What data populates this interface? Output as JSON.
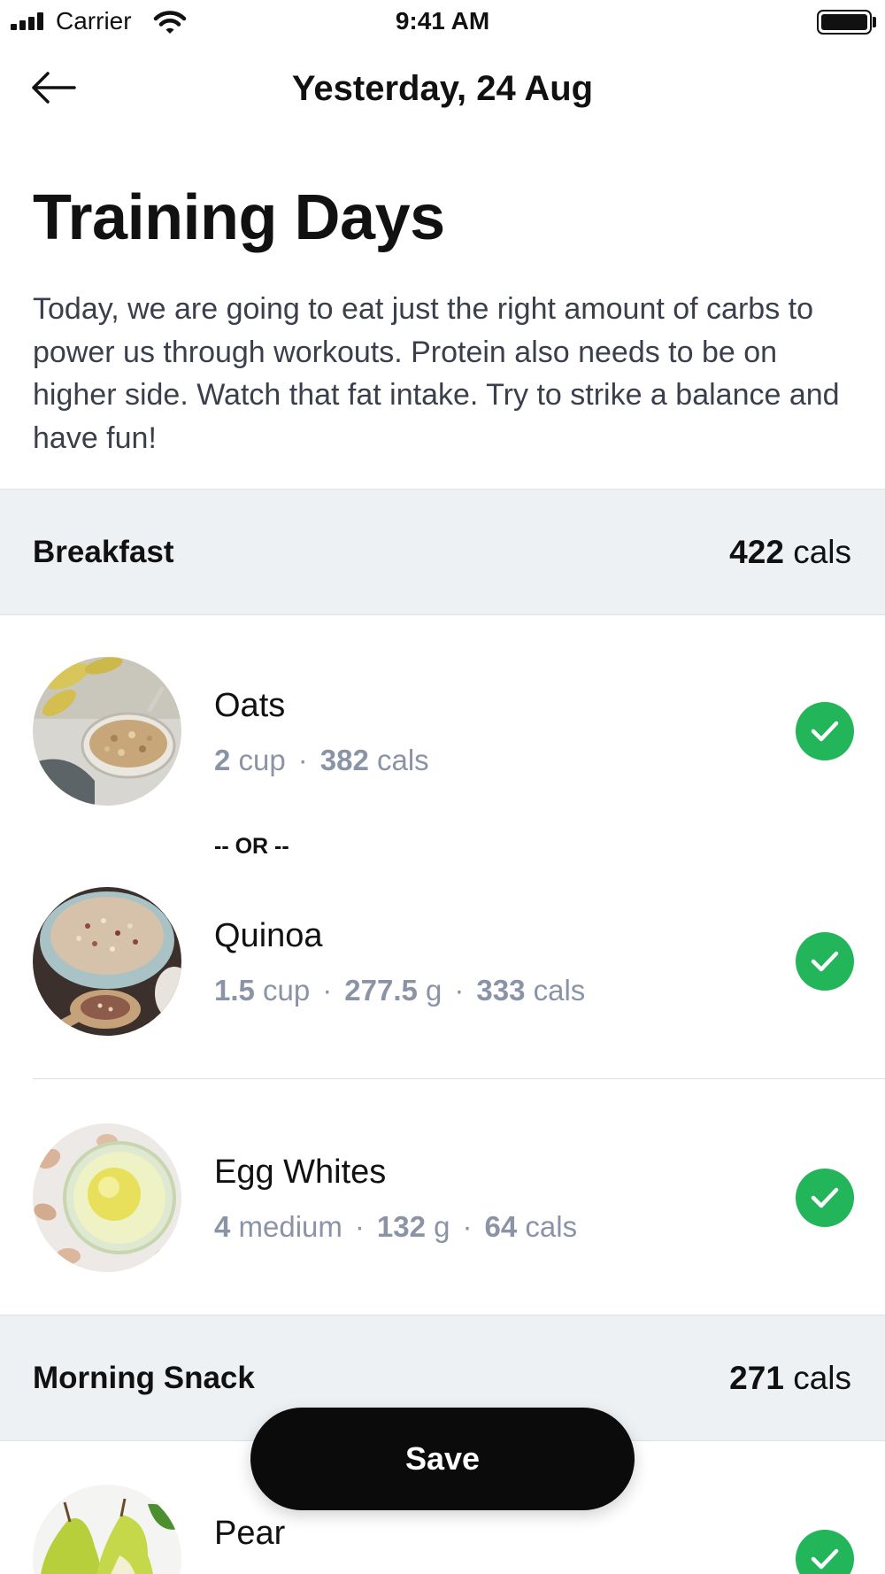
{
  "status_bar": {
    "carrier": "Carrier",
    "time": "9:41 AM"
  },
  "nav": {
    "back_icon": "arrow-left-icon",
    "title": "Yesterday, 24 Aug"
  },
  "page": {
    "title": "Training Days",
    "description": "Today, we are going to eat just the right amount of carbs to power us through workouts. Protein also needs to be on higher side. Watch that fat intake. Try to strike a balance and have fun!"
  },
  "sections": [
    {
      "title": "Breakfast",
      "cals_value": "422",
      "cals_unit": "cals",
      "items": [
        {
          "name": "Oats",
          "meta": [
            {
              "v": "2",
              "u": "cup"
            },
            {
              "v": "382",
              "u": "cals"
            }
          ],
          "checked": true
        },
        {
          "name": "Quinoa",
          "meta": [
            {
              "v": "1.5",
              "u": "cup"
            },
            {
              "v": "277.5",
              "u": "g"
            },
            {
              "v": "333",
              "u": "cals"
            }
          ],
          "checked": true
        },
        {
          "name": "Egg Whites",
          "meta": [
            {
              "v": "4",
              "u": "medium"
            },
            {
              "v": "132",
              "u": "g"
            },
            {
              "v": "64",
              "u": "cals"
            }
          ],
          "checked": true
        }
      ],
      "or_label": "-- OR --"
    },
    {
      "title": "Morning Snack",
      "cals_value": "271",
      "cals_unit": "cals",
      "items": [
        {
          "name": "Pear",
          "checked": true
        }
      ]
    }
  ],
  "save_label": "Save",
  "colors": {
    "check_green": "#22b55a",
    "section_bg": "#eef1f4",
    "meta_gray": "#8a94a6",
    "save_bg": "#0b0b0b"
  }
}
